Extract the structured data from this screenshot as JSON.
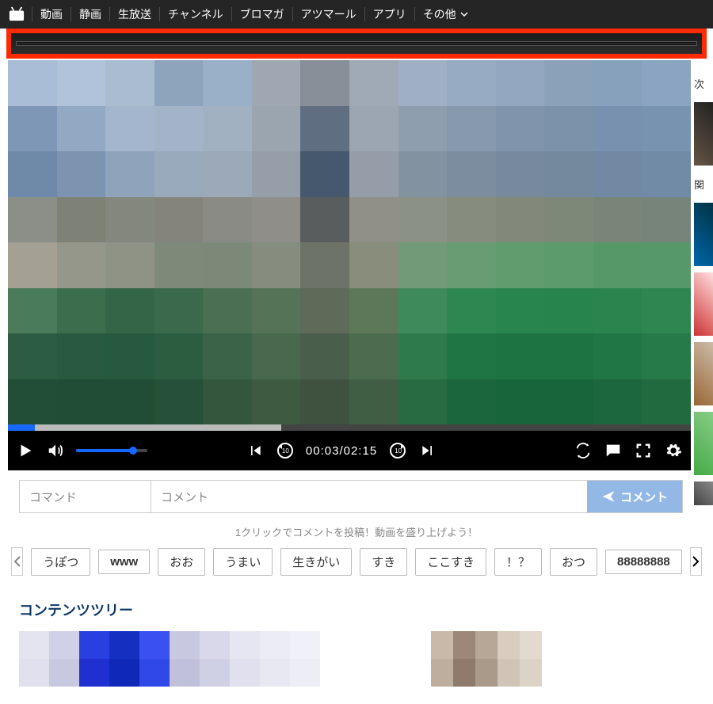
{
  "nav": {
    "items": [
      "動画",
      "静画",
      "生放送",
      "チャンネル",
      "ブロマガ",
      "アツマール",
      "アプリ",
      "その他"
    ]
  },
  "player": {
    "current_time": "00:03",
    "duration": "02:15",
    "seek_played_pct": 4,
    "seek_buffered_pct": 40,
    "volume_pct": 80,
    "rewind_amount": "10",
    "forward_amount": "10"
  },
  "comment": {
    "command_placeholder": "コマンド",
    "text_placeholder": "コメント",
    "send_label": "コメント",
    "hint": "1クリックでコメントを投稿！動画を盛り上げよう！"
  },
  "easy_comments": [
    "うぽつ",
    "www",
    "おお",
    "うまい",
    "生きがい",
    "すき",
    "ここすき",
    "！？",
    "おつ",
    "88888888"
  ],
  "section": {
    "content_tree_title": "コンテンツツリー"
  },
  "sidebar": {
    "next_label": "次",
    "related_label": "関"
  },
  "colors": {
    "accent": "#1768ff",
    "highlight": "#ff2a00"
  }
}
